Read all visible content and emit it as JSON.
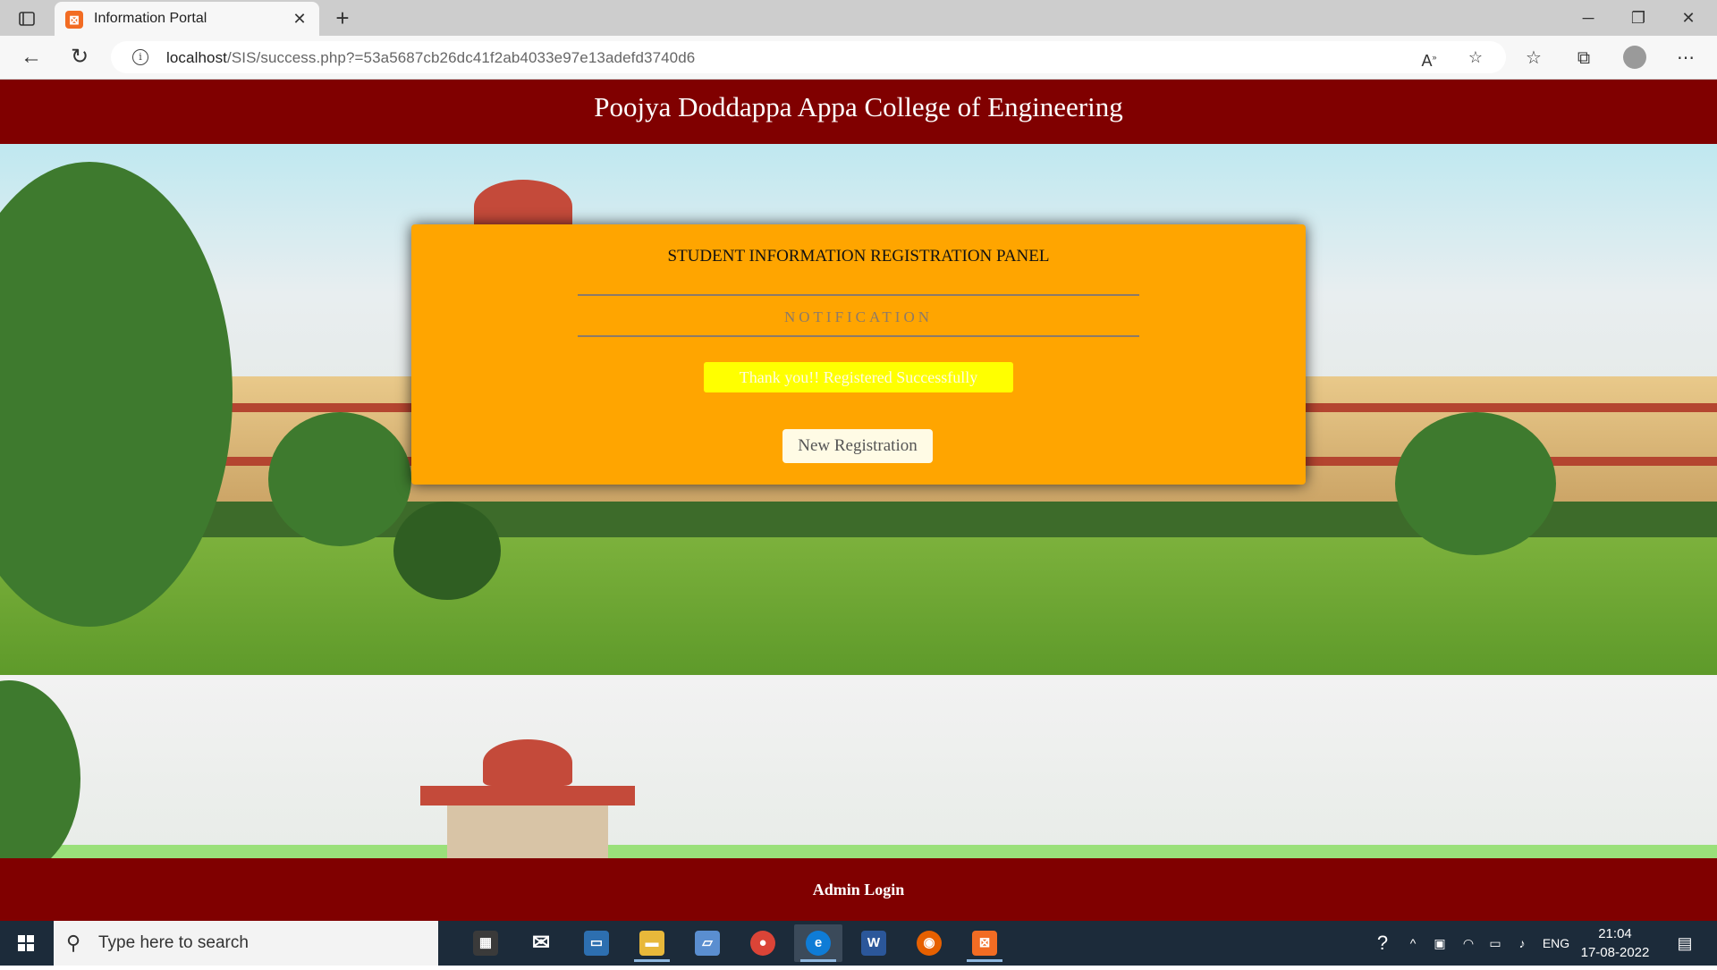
{
  "browser": {
    "tab_title": "Information Portal",
    "tab_favicon": "xampp-icon",
    "url_host": "localhost",
    "url_path": "/SIS/success.php?=53a5687cb26dc41f2ab4033e97e13adefd3740d6"
  },
  "page": {
    "header_title": "Poojya Doddappa Appa College of Engineering",
    "panel_title": "STUDENT INFORMATION REGISTRATION PANEL",
    "notification_label": "NOTIFICATION",
    "success_message": "Thank you!! Registered Successfully",
    "new_registration_button": "New Registration",
    "footer_link": "Admin Login"
  },
  "taskbar": {
    "search_placeholder": "Type here to search",
    "apps": [
      {
        "name": "microsoft-store-icon",
        "color": "#2d2d2d"
      },
      {
        "name": "mail-icon",
        "color": "#2d2d2d"
      },
      {
        "name": "remote-desktop-icon",
        "color": "#2d6fb0"
      },
      {
        "name": "file-explorer-icon",
        "color": "#e8b83a"
      },
      {
        "name": "notepad-icon",
        "color": "#5a8ed0"
      },
      {
        "name": "chrome-icon",
        "color": "#db4437"
      },
      {
        "name": "edge-icon",
        "color": "#0f7cd6"
      },
      {
        "name": "word-icon",
        "color": "#2b579a"
      },
      {
        "name": "firefox-icon",
        "color": "#e66000"
      },
      {
        "name": "xampp-icon",
        "color": "#f26c23"
      }
    ],
    "language": "ENG",
    "time": "21:04",
    "date": "17-08-2022"
  },
  "colors": {
    "header_bg": "#800000",
    "panel_bg": "#ffa500",
    "success_bg": "#ffff00"
  }
}
